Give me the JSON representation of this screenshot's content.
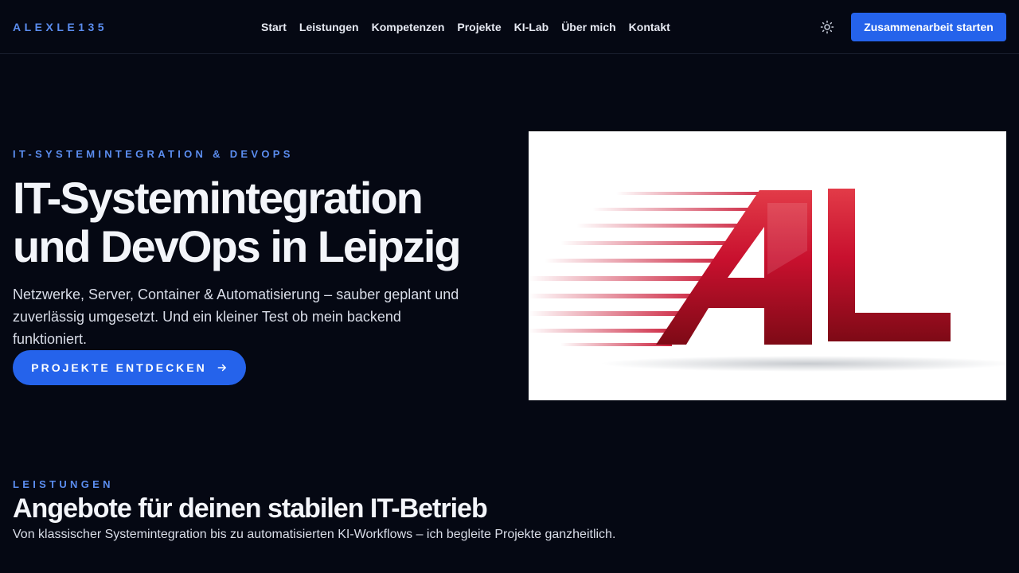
{
  "header": {
    "brand": "ALEXLE135",
    "nav": [
      "Start",
      "Leistungen",
      "Kompetenzen",
      "Projekte",
      "KI-Lab",
      "Über mich",
      "Kontakt"
    ],
    "theme_icon": "sun-icon",
    "cta_label": "Zusammenarbeit starten"
  },
  "hero": {
    "eyebrow": "IT-SYSTEMINTEGRATION & DEVOPS",
    "title_line1": "IT-Systemintegration",
    "title_line2": "und DevOps in Leipzig",
    "text": "Netzwerke, Server, Container & Automatisierung – sauber geplant und zuverlässig umgesetzt. Und ein kleiner Test ob mein backend funktioniert.",
    "button_label": "PROJEKTE ENTDECKEN",
    "button_icon": "arrow-right-icon",
    "logo_text": "AL"
  },
  "services": {
    "eyebrow": "LEISTUNGEN",
    "title": "Angebote für deinen stabilen IT-Betrieb",
    "text": "Von klassischer Systemintegration bis zu automatisierten KI-Workflows – ich begleite Projekte ganzheitlich."
  },
  "colors": {
    "background": "#050813",
    "accent": "#2563eb",
    "eyebrow": "#5b8def",
    "logo_red": "#c8102e"
  }
}
